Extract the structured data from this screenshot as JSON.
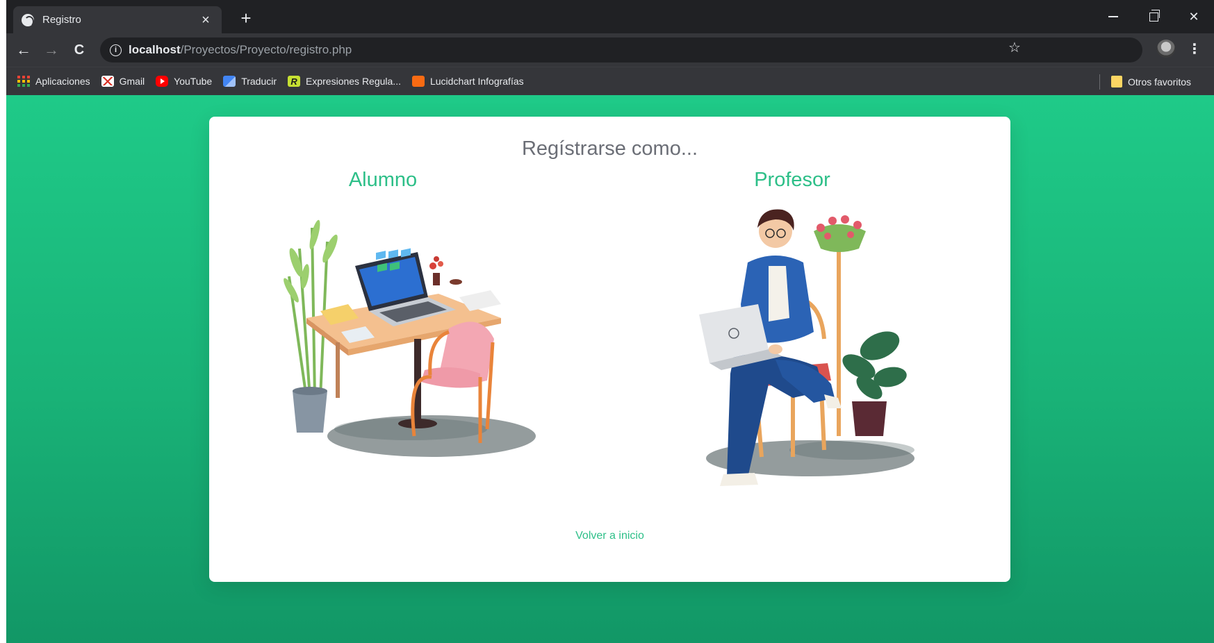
{
  "browser": {
    "tab": {
      "title": "Registro",
      "close": "×"
    },
    "new_tab": "+",
    "window_controls": {
      "close": "✕"
    },
    "nav": {
      "back": "←",
      "forward": "→",
      "reload": "C"
    },
    "address": {
      "host": "localhost",
      "path": "/Proyectos/Proyecto/registro.php"
    },
    "bookmarks": [
      {
        "label": "Aplicaciones",
        "icon": "apps-grid-icon"
      },
      {
        "label": "Gmail",
        "icon": "gmail-icon"
      },
      {
        "label": "YouTube",
        "icon": "youtube-icon"
      },
      {
        "label": "Traducir",
        "icon": "translate-icon"
      },
      {
        "label": "Expresiones Regula...",
        "icon": "regex-icon"
      },
      {
        "label": "Lucidchart Infografías",
        "icon": "lucidchart-icon"
      }
    ],
    "other_bookmarks": "Otros favoritos"
  },
  "page": {
    "title": "Regístrarse como...",
    "roles": [
      {
        "label": "Alumno",
        "illustration": "student-desk-laptop-illustration"
      },
      {
        "label": "Profesor",
        "illustration": "teacher-chair-laptop-illustration"
      }
    ],
    "back_link": "Volver a inicio"
  },
  "colors": {
    "accent": "#2dbf88",
    "background_top": "#1fca88",
    "background_bottom": "#129766",
    "title_text": "#6b6e76"
  }
}
